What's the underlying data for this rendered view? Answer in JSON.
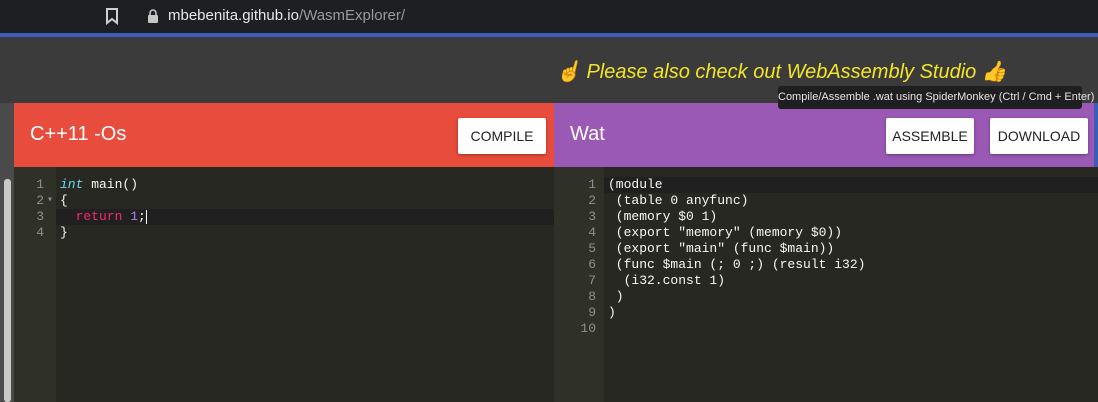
{
  "browser": {
    "url_host": "mbebenita.github.io",
    "url_path": "/WasmExplorer/"
  },
  "banner": {
    "promo_text": "☝ Please also check out WebAssembly Studio 👍"
  },
  "tooltip": "Compile/Assemble .wat using SpiderMonkey (Ctrl / Cmd + Enter)",
  "left_pane": {
    "title": "C++11 -Os",
    "compile_label": "COMPILE",
    "code_lines": [
      {
        "n": "1",
        "parts": [
          {
            "t": "int",
            "c": "kw-type"
          },
          {
            "t": " main()"
          }
        ]
      },
      {
        "n": "2",
        "parts": [
          {
            "t": "{"
          }
        ]
      },
      {
        "n": "3",
        "parts": [
          {
            "t": "  "
          },
          {
            "t": "return",
            "c": "kw-ret"
          },
          {
            "t": " "
          },
          {
            "t": "1",
            "c": "num"
          },
          {
            "t": ";"
          }
        ]
      },
      {
        "n": "4",
        "parts": [
          {
            "t": "}"
          }
        ]
      }
    ]
  },
  "right_pane": {
    "title": "Wat",
    "assemble_label": "ASSEMBLE",
    "download_label": "DOWNLOAD",
    "code_lines": [
      {
        "n": "1",
        "parts": [
          {
            "t": "(module"
          }
        ]
      },
      {
        "n": "2",
        "parts": [
          {
            "t": " (table 0 anyfunc)"
          }
        ]
      },
      {
        "n": "3",
        "parts": [
          {
            "t": " (memory $0 1)"
          }
        ]
      },
      {
        "n": "4",
        "parts": [
          {
            "t": " (export \"memory\" (memory $0))"
          }
        ]
      },
      {
        "n": "5",
        "parts": [
          {
            "t": " (export \"main\" (func $main))"
          }
        ]
      },
      {
        "n": "6",
        "parts": [
          {
            "t": " (func $main (; 0 ;) (result i32)"
          }
        ]
      },
      {
        "n": "7",
        "parts": [
          {
            "t": "  (i32.const 1)"
          }
        ]
      },
      {
        "n": "8",
        "parts": [
          {
            "t": " )"
          }
        ]
      },
      {
        "n": "9",
        "parts": [
          {
            "t": ")"
          }
        ]
      },
      {
        "n": "10",
        "parts": [
          {
            "t": ""
          }
        ]
      }
    ]
  },
  "colors": {
    "cpp_header": "#e74c3c",
    "wat_header": "#9b59b6",
    "promo_text": "#f5e52a",
    "editor_bg": "#272822"
  }
}
